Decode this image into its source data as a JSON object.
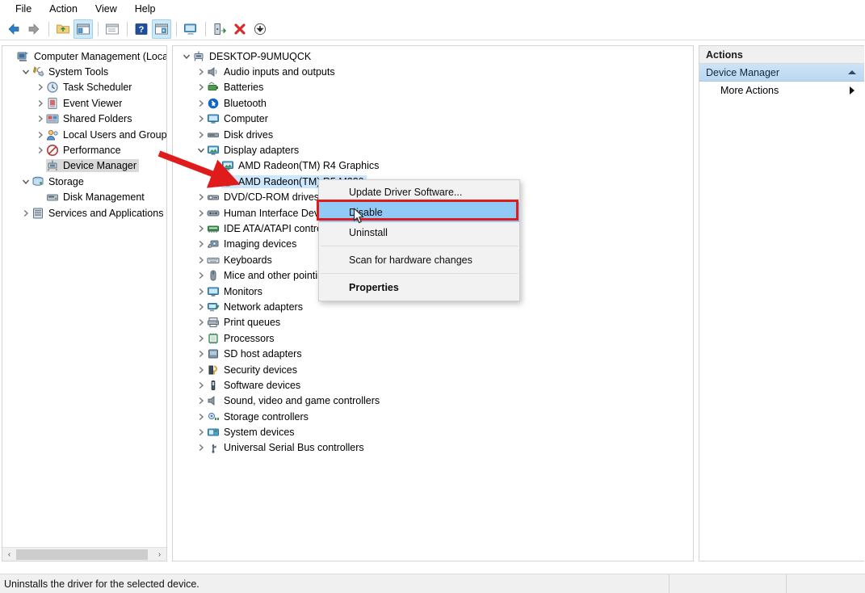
{
  "window": {
    "title": "Computer Management"
  },
  "menubar": {
    "items": [
      {
        "label": "File",
        "name": "menu-file"
      },
      {
        "label": "Action",
        "name": "menu-action"
      },
      {
        "label": "View",
        "name": "menu-view"
      },
      {
        "label": "Help",
        "name": "menu-help"
      }
    ]
  },
  "toolbar": {
    "buttons": [
      {
        "icon": "back-arrow-icon",
        "tip": "Back"
      },
      {
        "icon": "forward-arrow-icon",
        "tip": "Forward"
      },
      {
        "icon": "up-folder-icon",
        "tip": "Up One Level"
      },
      {
        "icon": "show-hide-console-tree-icon",
        "tip": "Show/Hide Console Tree",
        "selected": true
      },
      {
        "icon": "properties-window-icon",
        "tip": "Properties"
      },
      {
        "icon": "help-question-icon",
        "tip": "Help"
      },
      {
        "icon": "show-action-pane-icon",
        "tip": "Show/Hide Action Pane",
        "selected": true
      },
      {
        "icon": "scan-monitor-icon",
        "tip": "Scan for hardware changes"
      },
      {
        "icon": "update-driver-icon",
        "tip": "Update Driver Software"
      },
      {
        "icon": "uninstall-red-x-icon",
        "tip": "Uninstall"
      },
      {
        "icon": "disable-down-arrow-icon",
        "tip": "Disable"
      }
    ]
  },
  "console_tree": {
    "items": [
      {
        "label": "Computer Management (Local",
        "indent": 0,
        "expander": "none",
        "icon": "computer-management-icon",
        "selected": false
      },
      {
        "label": "System Tools",
        "indent": 1,
        "expander": "expanded",
        "icon": "system-tools-icon",
        "selected": false
      },
      {
        "label": "Task Scheduler",
        "indent": 2,
        "expander": "collapsed",
        "icon": "clock-icon",
        "selected": false
      },
      {
        "label": "Event Viewer",
        "indent": 2,
        "expander": "collapsed",
        "icon": "event-viewer-icon",
        "selected": false
      },
      {
        "label": "Shared Folders",
        "indent": 2,
        "expander": "collapsed",
        "icon": "shared-folders-icon",
        "selected": false
      },
      {
        "label": "Local Users and Groups",
        "indent": 2,
        "expander": "collapsed",
        "icon": "users-icon",
        "selected": false
      },
      {
        "label": "Performance",
        "indent": 2,
        "expander": "collapsed",
        "icon": "performance-icon",
        "selected": false
      },
      {
        "label": "Device Manager",
        "indent": 2,
        "expander": "none",
        "icon": "device-manager-icon",
        "selected": true
      },
      {
        "label": "Storage",
        "indent": 1,
        "expander": "expanded",
        "icon": "storage-icon",
        "selected": false
      },
      {
        "label": "Disk Management",
        "indent": 2,
        "expander": "none",
        "icon": "disk-management-icon",
        "selected": false
      },
      {
        "label": "Services and Applications",
        "indent": 1,
        "expander": "collapsed",
        "icon": "services-icon",
        "selected": false
      }
    ],
    "scrollbar": {
      "left_arrow": "‹",
      "right_arrow": "›"
    }
  },
  "device_tree": {
    "root": {
      "label": "DESKTOP-9UMUQCK",
      "icon": "computer-node-icon",
      "expander": "expanded"
    },
    "items": [
      {
        "label": "Audio inputs and outputs",
        "icon": "speaker-icon",
        "expander": "collapsed",
        "indent": 1
      },
      {
        "label": "Batteries",
        "icon": "battery-icon",
        "expander": "collapsed",
        "indent": 1
      },
      {
        "label": "Bluetooth",
        "icon": "bluetooth-icon",
        "expander": "collapsed",
        "indent": 1
      },
      {
        "label": "Computer",
        "icon": "monitor-icon",
        "expander": "collapsed",
        "indent": 1
      },
      {
        "label": "Disk drives",
        "icon": "disk-drive-icon",
        "expander": "collapsed",
        "indent": 1
      },
      {
        "label": "Display adapters",
        "icon": "display-adapter-icon",
        "expander": "expanded",
        "indent": 1
      },
      {
        "label": "AMD Radeon(TM) R4 Graphics",
        "icon": "display-adapter-icon",
        "expander": "none",
        "indent": 2
      },
      {
        "label": "AMD Radeon(TM) R5 M330",
        "icon": "display-adapter-icon",
        "expander": "none",
        "indent": 2,
        "selected": true
      },
      {
        "label": "DVD/CD-ROM drives",
        "icon": "dvd-drive-icon",
        "expander": "collapsed",
        "indent": 1
      },
      {
        "label": "Human Interface Devices",
        "icon": "hid-icon",
        "expander": "collapsed",
        "indent": 1
      },
      {
        "label": "IDE ATA/ATAPI controllers",
        "icon": "ide-controller-icon",
        "expander": "collapsed",
        "indent": 1
      },
      {
        "label": "Imaging devices",
        "icon": "imaging-icon",
        "expander": "collapsed",
        "indent": 1
      },
      {
        "label": "Keyboards",
        "icon": "keyboard-icon",
        "expander": "collapsed",
        "indent": 1
      },
      {
        "label": "Mice and other pointing devices",
        "icon": "mouse-icon",
        "expander": "collapsed",
        "indent": 1
      },
      {
        "label": "Monitors",
        "icon": "monitor-icon",
        "expander": "collapsed",
        "indent": 1
      },
      {
        "label": "Network adapters",
        "icon": "network-adapter-icon",
        "expander": "collapsed",
        "indent": 1
      },
      {
        "label": "Print queues",
        "icon": "printer-icon",
        "expander": "collapsed",
        "indent": 1
      },
      {
        "label": "Processors",
        "icon": "processor-icon",
        "expander": "collapsed",
        "indent": 1
      },
      {
        "label": "SD host adapters",
        "icon": "sd-host-icon",
        "expander": "collapsed",
        "indent": 1
      },
      {
        "label": "Security devices",
        "icon": "security-device-icon",
        "expander": "collapsed",
        "indent": 1
      },
      {
        "label": "Software devices",
        "icon": "software-device-icon",
        "expander": "collapsed",
        "indent": 1
      },
      {
        "label": "Sound, video and game controllers",
        "icon": "sound-controller-icon",
        "expander": "collapsed",
        "indent": 1
      },
      {
        "label": "Storage controllers",
        "icon": "storage-controller-icon",
        "expander": "collapsed",
        "indent": 1
      },
      {
        "label": "System devices",
        "icon": "system-device-icon",
        "expander": "collapsed",
        "indent": 1
      },
      {
        "label": "Universal Serial Bus controllers",
        "icon": "usb-controller-icon",
        "expander": "collapsed",
        "indent": 1
      }
    ]
  },
  "context_menu": {
    "items": [
      {
        "label": "Update Driver Software...",
        "bold": false,
        "highlighted": false,
        "separator_after": false
      },
      {
        "label": "Disable",
        "bold": false,
        "highlighted": true,
        "separator_after": false
      },
      {
        "label": "Uninstall",
        "bold": false,
        "highlighted": false,
        "separator_after": true
      },
      {
        "label": "Scan for hardware changes",
        "bold": false,
        "highlighted": false,
        "separator_after": true
      },
      {
        "label": "Properties",
        "bold": true,
        "highlighted": false,
        "separator_after": false
      }
    ]
  },
  "actions_pane": {
    "title": "Actions",
    "group_label": "Device Manager",
    "items": [
      {
        "label": "More Actions",
        "submenu": true
      }
    ]
  },
  "statusbar": {
    "text": "Uninstalls the driver for the selected device."
  },
  "annotation": {
    "arrow_color": "#e01b1b",
    "highlight_box_color": "#e01b1b"
  },
  "colors": {
    "selection_blue": "#cce8ff",
    "menu_highlight_blue": "#91c9f7",
    "actions_group_blue": "#b9d7f0",
    "annotation_red": "#e01b1b"
  }
}
